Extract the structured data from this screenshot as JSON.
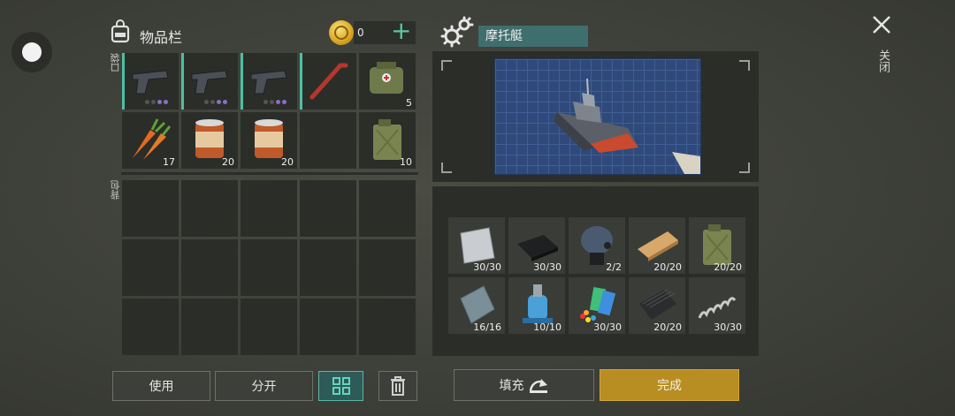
{
  "inventory": {
    "title": "物品栏",
    "coins": "0",
    "pocket_label": "口袋",
    "backpack_label": "背包",
    "pocket_slots": [
      {
        "icon": "pistol-icon",
        "count": "",
        "dots": true
      },
      {
        "icon": "pistol-icon",
        "count": "",
        "dots": true
      },
      {
        "icon": "pistol-icon",
        "count": "",
        "dots": true
      },
      {
        "icon": "crowbar-icon",
        "count": "",
        "dots": false
      },
      {
        "icon": "medkit-bag-icon",
        "count": "5",
        "dots": false
      },
      {
        "icon": "carrot-icon",
        "count": "17",
        "dots": false
      },
      {
        "icon": "canned-food-icon",
        "count": "20",
        "dots": false
      },
      {
        "icon": "canned-food-icon",
        "count": "20",
        "dots": false
      },
      {
        "icon": "",
        "count": "",
        "dots": false
      },
      {
        "icon": "jerrycan-icon",
        "count": "10",
        "dots": false
      }
    ],
    "backpack_slot_count": 15
  },
  "craft": {
    "name": "摩托艇",
    "item_icon": "motorboat-icon",
    "materials": [
      {
        "icon": "metal-sheet-icon",
        "count": "30/30"
      },
      {
        "icon": "rubber-sheet-icon",
        "count": "30/30"
      },
      {
        "icon": "engine-part-icon",
        "count": "2/2"
      },
      {
        "icon": "wood-plank-icon",
        "count": "20/20"
      },
      {
        "icon": "jerrycan-icon",
        "count": "20/20"
      },
      {
        "icon": "steel-plate-icon",
        "count": "16/16"
      },
      {
        "icon": "pump-icon",
        "count": "10/10"
      },
      {
        "icon": "electronics-icon",
        "count": "30/30"
      },
      {
        "icon": "carbon-plate-icon",
        "count": "20/20"
      },
      {
        "icon": "spring-icon",
        "count": "30/30"
      }
    ]
  },
  "close_label": "关闭",
  "buttons": {
    "use": "使用",
    "split": "分开",
    "fill": "填充",
    "done": "完成"
  },
  "colors": {
    "accent": "#5fc4a6",
    "done": "#b88d22",
    "craft_name_bg": "#3f6e6e"
  }
}
